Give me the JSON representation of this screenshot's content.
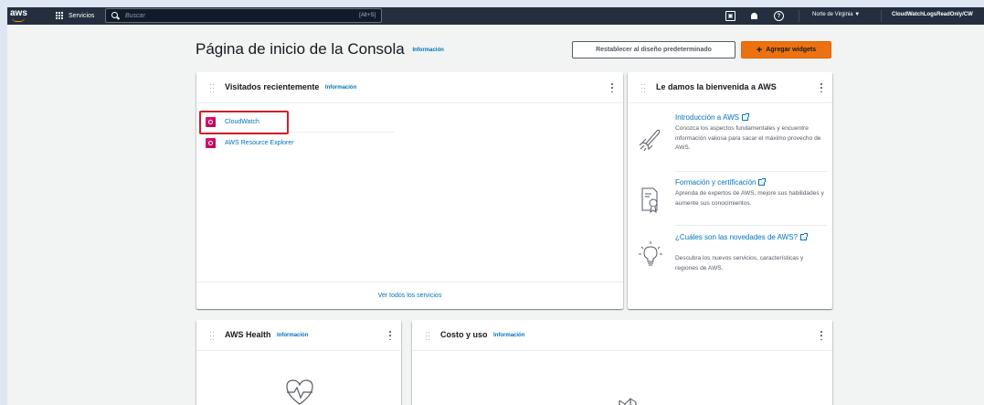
{
  "nav": {
    "services_label": "Servicios",
    "search_placeholder": "Buscar",
    "search_shortcut": "[Alt+S]",
    "cloudshell_glyph": "▣",
    "help_glyph": "?",
    "region": "Norte de Virginia ▼",
    "account": "CloudWatchLogsReadOnly/CW"
  },
  "header": {
    "title": "Página de inicio de la Consola",
    "info": "Información",
    "reset_label": "Restablecer al diseño predeterminado",
    "add_widgets_label": "Agregar widgets",
    "add_icon": "+"
  },
  "recent": {
    "title": "Visitados recientemente",
    "info": "Información",
    "items": [
      {
        "label": "CloudWatch",
        "icon": "cloudwatch-icon"
      },
      {
        "label": "AWS Resource Explorer",
        "icon": "resource-explorer-icon"
      }
    ],
    "footer": "Ver todos los servicios"
  },
  "welcome": {
    "title": "Le damos la bienvenida a AWS",
    "items": [
      {
        "link": "Introducción a AWS",
        "desc": "Conozca los aspectos fundamentales y encuentre información valiosa para sacar el máximo provecho de AWS.",
        "icon": "rocket-icon"
      },
      {
        "link": "Formación y certificación",
        "desc": "Aprenda de expertos de AWS, mejore sus habilidades y aumente sus conocimientos.",
        "icon": "certificate-icon"
      },
      {
        "link": "¿Cuáles son las novedades de AWS?",
        "desc": "Descubra los nuevos servicios, características y regiones de AWS.",
        "icon": "lightbulb-icon"
      }
    ]
  },
  "health": {
    "title": "AWS Health",
    "info": "Información"
  },
  "cost": {
    "title": "Costo y uso",
    "info": "Información"
  },
  "colors": {
    "nav_bg": "#232f3e",
    "link": "#0073bb",
    "accent": "#ec7211",
    "highlight": "#d0202a"
  }
}
